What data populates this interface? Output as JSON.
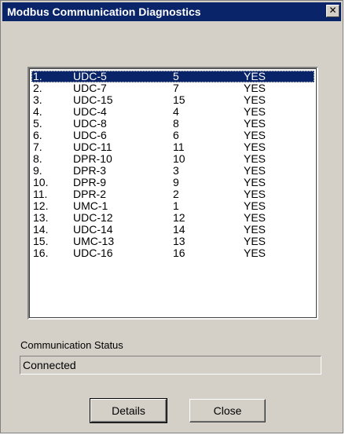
{
  "window": {
    "title": "Modbus Communication Diagnostics",
    "close_glyph": "✕"
  },
  "list": {
    "rows": [
      {
        "num": "1.",
        "name": "UDC-5",
        "address": "5",
        "status": "YES",
        "selected": true
      },
      {
        "num": "2.",
        "name": "UDC-7",
        "address": "7",
        "status": "YES"
      },
      {
        "num": "3.",
        "name": "UDC-15",
        "address": "15",
        "status": "YES"
      },
      {
        "num": "4.",
        "name": "UDC-4",
        "address": "4",
        "status": "YES"
      },
      {
        "num": "5.",
        "name": "UDC-8",
        "address": "8",
        "status": "YES"
      },
      {
        "num": "6.",
        "name": "UDC-6",
        "address": "6",
        "status": "YES"
      },
      {
        "num": "7.",
        "name": "UDC-11",
        "address": "11",
        "status": "YES"
      },
      {
        "num": "8.",
        "name": "DPR-10",
        "address": "10",
        "status": "YES"
      },
      {
        "num": "9.",
        "name": "DPR-3",
        "address": "3",
        "status": "YES"
      },
      {
        "num": "10.",
        "name": "DPR-9",
        "address": "9",
        "status": "YES"
      },
      {
        "num": "11.",
        "name": "DPR-2",
        "address": "2",
        "status": "YES"
      },
      {
        "num": "12.",
        "name": "UMC-1",
        "address": "1",
        "status": "YES"
      },
      {
        "num": "13.",
        "name": "UDC-12",
        "address": "12",
        "status": "YES"
      },
      {
        "num": "14.",
        "name": "UDC-14",
        "address": "14",
        "status": "YES"
      },
      {
        "num": "15.",
        "name": "UMC-13",
        "address": "13",
        "status": "YES"
      },
      {
        "num": "16.",
        "name": "UDC-16",
        "address": "16",
        "status": "YES"
      }
    ]
  },
  "status": {
    "label": "Communication Status",
    "value": "Connected"
  },
  "buttons": {
    "details": "Details",
    "close": "Close"
  },
  "colors": {
    "titlebar": "#0a246a",
    "selection": "#0a246a",
    "face": "#d4d0c8"
  }
}
